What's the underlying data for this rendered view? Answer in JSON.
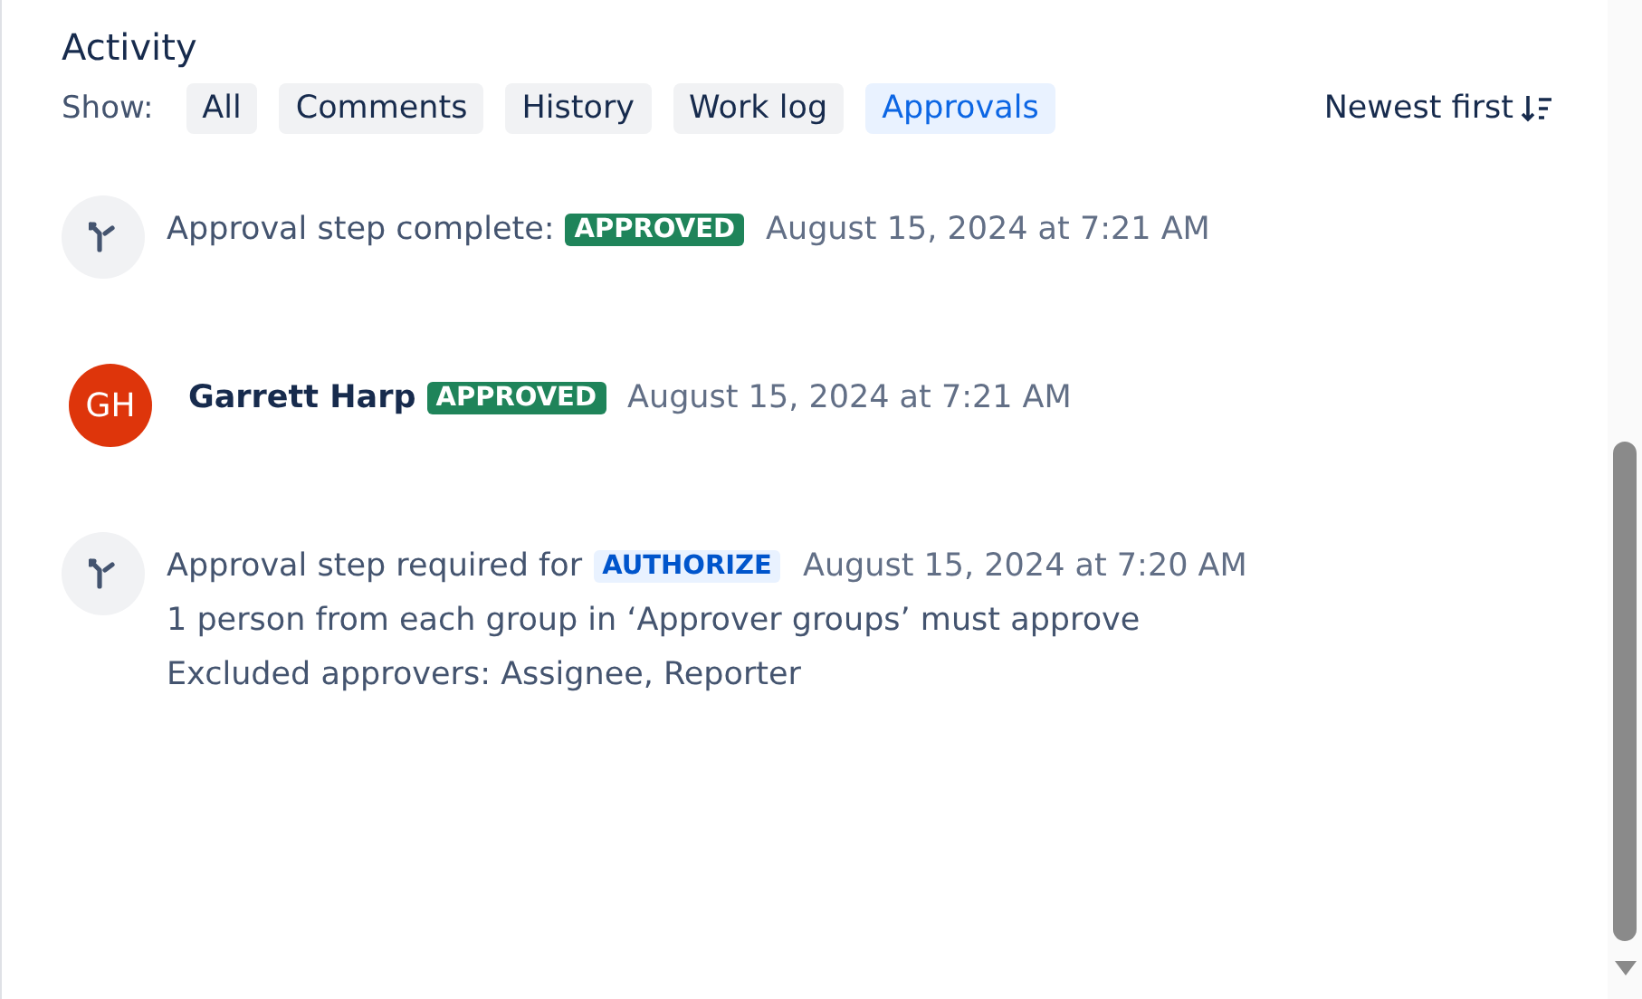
{
  "title": "Activity",
  "filter": {
    "label": "Show:",
    "options": [
      {
        "label": "All",
        "selected": false
      },
      {
        "label": "Comments",
        "selected": false
      },
      {
        "label": "History",
        "selected": false
      },
      {
        "label": "Work log",
        "selected": false
      },
      {
        "label": "Approvals",
        "selected": true
      }
    ]
  },
  "sort": {
    "label": "Newest first"
  },
  "entries": [
    {
      "kind": "step",
      "text": "Approval step complete:",
      "lozenge": {
        "label": "APPROVED",
        "kind": "success"
      },
      "time": "August 15, 2024 at 7:21 AM"
    },
    {
      "kind": "user",
      "initials": "GH",
      "color": "#de350b",
      "name": "Garrett Harp",
      "lozenge": {
        "label": "APPROVED",
        "kind": "success"
      },
      "time": "August 15, 2024 at 7:21 AM"
    },
    {
      "kind": "step",
      "text": "Approval step required for",
      "lozenge": {
        "label": "AUTHORIZE",
        "kind": "info"
      },
      "time": "August 15, 2024 at 7:20 AM",
      "details": [
        "1 person from each group in ‘Approver groups’ must approve",
        "Excluded approvers: Assignee, Reporter"
      ]
    }
  ]
}
